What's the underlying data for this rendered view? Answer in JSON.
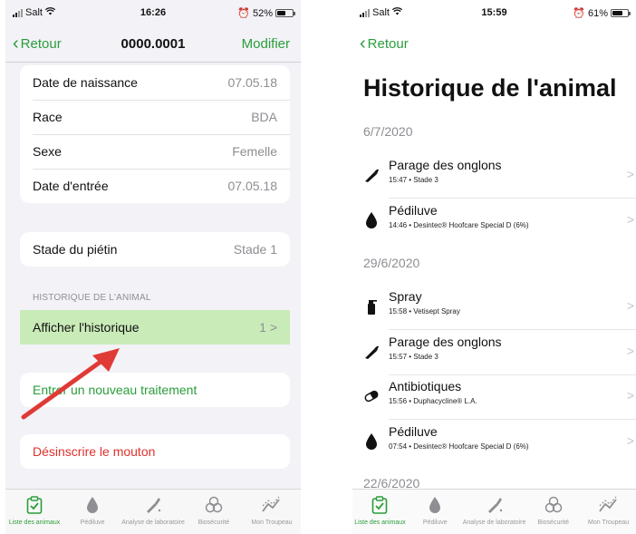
{
  "left": {
    "status": {
      "carrier": "Salt",
      "time": "16:26",
      "battery": "52%",
      "battery_level": 0.52
    },
    "nav": {
      "back": "Retour",
      "title": "0000.0001",
      "edit": "Modifier"
    },
    "details": [
      {
        "label": "Date de naissance",
        "value": "07.05.18"
      },
      {
        "label": "Race",
        "value": "BDA"
      },
      {
        "label": "Sexe",
        "value": "Femelle"
      },
      {
        "label": "Date d'entrée",
        "value": "07.05.18"
      }
    ],
    "stage": {
      "label": "Stade du piétin",
      "value": "Stade 1"
    },
    "history_header": "HISTORIQUE DE L'ANIMAL",
    "history_row": {
      "label": "Afficher l'historique",
      "count": "1",
      "chevron": ">"
    },
    "new_treatment": "Entrer un nouveau traitement",
    "unsubscribe": "Désinscrire le mouton"
  },
  "right": {
    "status": {
      "carrier": "Salt",
      "time": "15:59",
      "battery": "61%",
      "battery_level": 0.61
    },
    "nav": {
      "back": "Retour"
    },
    "title": "Historique de l'animal",
    "groups": [
      {
        "date": "6/7/2020",
        "items": [
          {
            "icon": "hoof-knife-icon",
            "title": "Parage des onglons",
            "subtitle": "15:47 • Stade 3"
          },
          {
            "icon": "drop-icon",
            "title": "Pédiluve",
            "subtitle": "14:46 • Desintec® Hoofcare Special D (6%)"
          }
        ]
      },
      {
        "date": "29/6/2020",
        "items": [
          {
            "icon": "spray-icon",
            "title": "Spray",
            "subtitle": "15:58 • Vetisept Spray"
          },
          {
            "icon": "hoof-knife-icon",
            "title": "Parage des onglons",
            "subtitle": "15:57 • Stade 3"
          },
          {
            "icon": "pill-icon",
            "title": "Antibiotiques",
            "subtitle": "15:56 • Duphacycline® L.A."
          },
          {
            "icon": "drop-icon",
            "title": "Pédiluve",
            "subtitle": "07:54 • Desintec® Hoofcare Special D (6%)"
          }
        ]
      },
      {
        "date": "22/6/2020",
        "items": []
      }
    ],
    "chevron": ">"
  },
  "tabs": [
    {
      "label": "Liste des animaux",
      "icon": "clipboard-check-icon",
      "active": true
    },
    {
      "label": "Pédiluve",
      "icon": "drop-icon",
      "active": false
    },
    {
      "label": "Analyse de laboratoire",
      "icon": "pipette-icon",
      "active": false
    },
    {
      "label": "Biosécurité",
      "icon": "biohazard-icon",
      "active": false
    },
    {
      "label": "Mon Troupeau",
      "icon": "trend-icon",
      "active": false
    }
  ],
  "colors": {
    "accent": "#2a9d3a",
    "danger": "#e0302c",
    "highlight": "#c9ebb8",
    "arrow": "#e03a36"
  }
}
